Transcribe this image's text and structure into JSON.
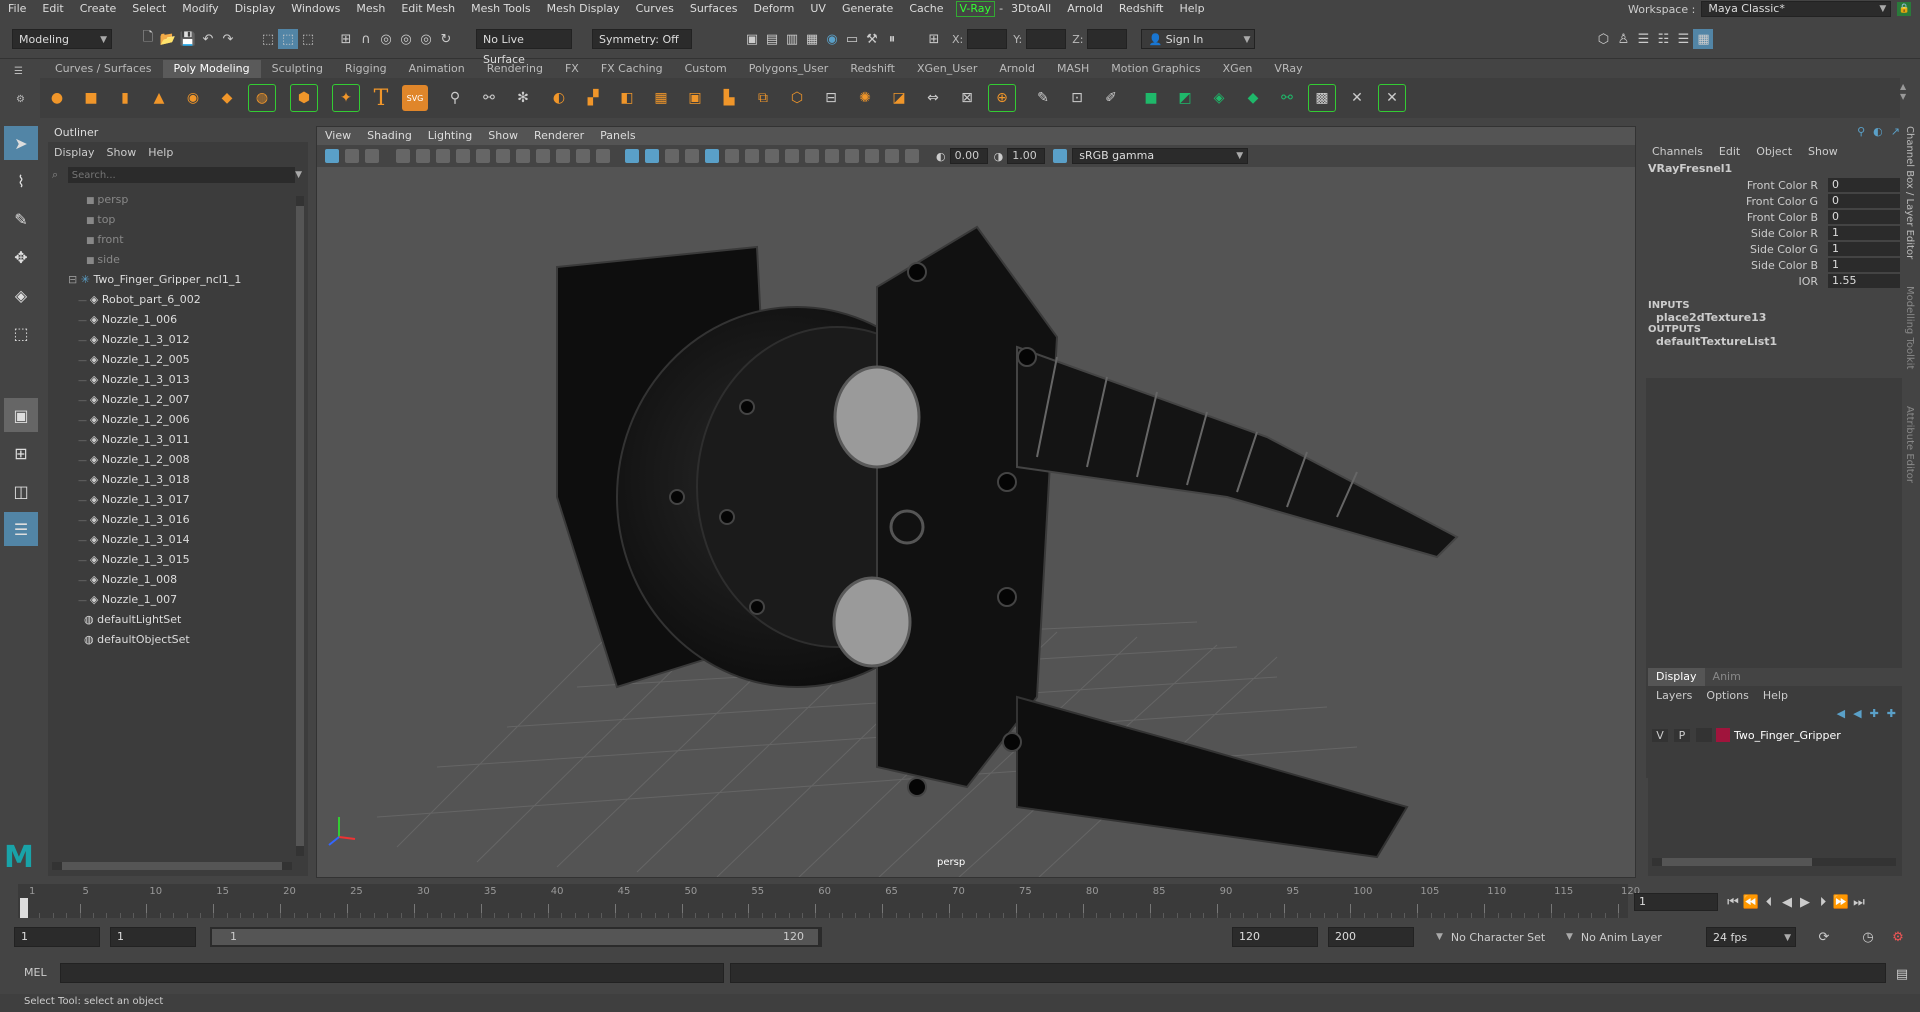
{
  "menubar": {
    "items": [
      "File",
      "Edit",
      "Create",
      "Select",
      "Modify",
      "Display",
      "Windows",
      "Mesh",
      "Edit Mesh",
      "Mesh Tools",
      "Mesh Display",
      "Curves",
      "Surfaces",
      "Deform",
      "UV",
      "Generate",
      "Cache",
      "V-Ray",
      "3DtoAll",
      "Arnold",
      "Redshift",
      "Help"
    ],
    "workspace_label": "Workspace :",
    "workspace_value": "Maya Classic*"
  },
  "statusline": {
    "mode": "Modeling",
    "live_surface": "No Live Surface",
    "symmetry": "Symmetry: Off",
    "x_label": "X:",
    "y_label": "Y:",
    "z_label": "Z:",
    "sign_in": "Sign In"
  },
  "shelf": {
    "tabs": [
      "Curves / Surfaces",
      "Poly Modeling",
      "Sculpting",
      "Rigging",
      "Animation",
      "Rendering",
      "FX",
      "FX Caching",
      "Custom",
      "Polygons_User",
      "Redshift",
      "XGen_User",
      "Arnold",
      "MASH",
      "Motion Graphics",
      "XGen",
      "VRay"
    ],
    "active_tab": "Poly Modeling",
    "svg_label": "SVG",
    "text_tool": "T"
  },
  "outliner": {
    "title": "Outliner",
    "menu": [
      "Display",
      "Show",
      "Help"
    ],
    "search_placeholder": "Search...",
    "cameras": [
      "persp",
      "top",
      "front",
      "side"
    ],
    "group": "Two_Finger_Gripper_ncl1_1",
    "children": [
      "Robot_part_6_002",
      "Nozzle_1_006",
      "Nozzle_1_3_012",
      "Nozzle_1_2_005",
      "Nozzle_1_3_013",
      "Nozzle_1_2_007",
      "Nozzle_1_2_006",
      "Nozzle_1_3_011",
      "Nozzle_1_2_008",
      "Nozzle_1_3_018",
      "Nozzle_1_3_017",
      "Nozzle_1_3_016",
      "Nozzle_1_3_014",
      "Nozzle_1_3_015",
      "Nozzle_1_008",
      "Nozzle_1_007"
    ],
    "sets": [
      "defaultLightSet",
      "defaultObjectSet"
    ]
  },
  "viewport": {
    "menu": [
      "View",
      "Shading",
      "Lighting",
      "Show",
      "Renderer",
      "Panels"
    ],
    "exposure": "0.00",
    "gamma": "1.00",
    "color_space": "sRGB gamma",
    "camera_label": "persp"
  },
  "channelbox": {
    "menu": [
      "Channels",
      "Edit",
      "Object",
      "Show"
    ],
    "node": "VRayFresnel1",
    "attributes": [
      {
        "label": "Front Color R",
        "value": "0"
      },
      {
        "label": "Front Color G",
        "value": "0"
      },
      {
        "label": "Front Color B",
        "value": "0"
      },
      {
        "label": "Side Color R",
        "value": "1"
      },
      {
        "label": "Side Color G",
        "value": "1"
      },
      {
        "label": "Side Color B",
        "value": "1"
      },
      {
        "label": "IOR",
        "value": "1.55"
      }
    ],
    "inputs_label": "INPUTS",
    "input_node": "place2dTexture13",
    "outputs_label": "OUTPUTS",
    "output_node": "defaultTextureList1",
    "side_tabs": [
      "Channel Box / Layer Editor",
      "Modelling Toolkit",
      "Attribute Editor"
    ]
  },
  "layer_editor": {
    "tabs": [
      "Display",
      "Anim"
    ],
    "menu": [
      "Layers",
      "Options",
      "Help"
    ],
    "layer": {
      "v": "V",
      "p": "P",
      "name": "Two_Finger_Gripper",
      "color": "#a0143c"
    }
  },
  "timeslider": {
    "ticks": [
      "1",
      "5",
      "10",
      "15",
      "20",
      "25",
      "30",
      "35",
      "40",
      "45",
      "50",
      "55",
      "60",
      "65",
      "70",
      "75",
      "80",
      "85",
      "90",
      "95",
      "100",
      "105",
      "110",
      "115",
      "120"
    ],
    "current_frame": "1"
  },
  "range": {
    "start": "1",
    "playback_start": "1",
    "range_start": "1",
    "range_end": "120",
    "playback_end": "120",
    "end": "200",
    "character_set": "No Character Set",
    "anim_layer": "No Anim Layer",
    "fps": "24 fps"
  },
  "cmdline": {
    "label": "MEL"
  },
  "helpline": {
    "text": "Select Tool: select an object"
  },
  "colors": {
    "accent": "#5285a6",
    "vray": "#33ff33",
    "selected_shelf": "#5a5a5a"
  }
}
